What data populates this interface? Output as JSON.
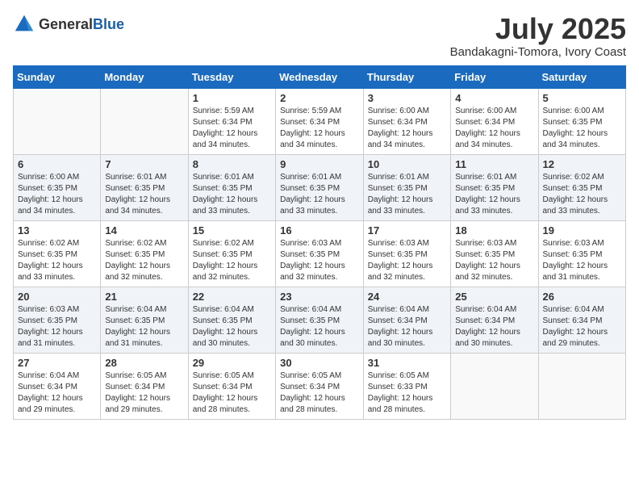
{
  "header": {
    "logo_general": "General",
    "logo_blue": "Blue",
    "month_title": "July 2025",
    "location": "Bandakagni-Tomora, Ivory Coast"
  },
  "days_of_week": [
    "Sunday",
    "Monday",
    "Tuesday",
    "Wednesday",
    "Thursday",
    "Friday",
    "Saturday"
  ],
  "weeks": [
    [
      {
        "day": "",
        "info": ""
      },
      {
        "day": "",
        "info": ""
      },
      {
        "day": "1",
        "info": "Sunrise: 5:59 AM\nSunset: 6:34 PM\nDaylight: 12 hours and 34 minutes."
      },
      {
        "day": "2",
        "info": "Sunrise: 5:59 AM\nSunset: 6:34 PM\nDaylight: 12 hours and 34 minutes."
      },
      {
        "day": "3",
        "info": "Sunrise: 6:00 AM\nSunset: 6:34 PM\nDaylight: 12 hours and 34 minutes."
      },
      {
        "day": "4",
        "info": "Sunrise: 6:00 AM\nSunset: 6:34 PM\nDaylight: 12 hours and 34 minutes."
      },
      {
        "day": "5",
        "info": "Sunrise: 6:00 AM\nSunset: 6:35 PM\nDaylight: 12 hours and 34 minutes."
      }
    ],
    [
      {
        "day": "6",
        "info": "Sunrise: 6:00 AM\nSunset: 6:35 PM\nDaylight: 12 hours and 34 minutes."
      },
      {
        "day": "7",
        "info": "Sunrise: 6:01 AM\nSunset: 6:35 PM\nDaylight: 12 hours and 34 minutes."
      },
      {
        "day": "8",
        "info": "Sunrise: 6:01 AM\nSunset: 6:35 PM\nDaylight: 12 hours and 33 minutes."
      },
      {
        "day": "9",
        "info": "Sunrise: 6:01 AM\nSunset: 6:35 PM\nDaylight: 12 hours and 33 minutes."
      },
      {
        "day": "10",
        "info": "Sunrise: 6:01 AM\nSunset: 6:35 PM\nDaylight: 12 hours and 33 minutes."
      },
      {
        "day": "11",
        "info": "Sunrise: 6:01 AM\nSunset: 6:35 PM\nDaylight: 12 hours and 33 minutes."
      },
      {
        "day": "12",
        "info": "Sunrise: 6:02 AM\nSunset: 6:35 PM\nDaylight: 12 hours and 33 minutes."
      }
    ],
    [
      {
        "day": "13",
        "info": "Sunrise: 6:02 AM\nSunset: 6:35 PM\nDaylight: 12 hours and 33 minutes."
      },
      {
        "day": "14",
        "info": "Sunrise: 6:02 AM\nSunset: 6:35 PM\nDaylight: 12 hours and 32 minutes."
      },
      {
        "day": "15",
        "info": "Sunrise: 6:02 AM\nSunset: 6:35 PM\nDaylight: 12 hours and 32 minutes."
      },
      {
        "day": "16",
        "info": "Sunrise: 6:03 AM\nSunset: 6:35 PM\nDaylight: 12 hours and 32 minutes."
      },
      {
        "day": "17",
        "info": "Sunrise: 6:03 AM\nSunset: 6:35 PM\nDaylight: 12 hours and 32 minutes."
      },
      {
        "day": "18",
        "info": "Sunrise: 6:03 AM\nSunset: 6:35 PM\nDaylight: 12 hours and 32 minutes."
      },
      {
        "day": "19",
        "info": "Sunrise: 6:03 AM\nSunset: 6:35 PM\nDaylight: 12 hours and 31 minutes."
      }
    ],
    [
      {
        "day": "20",
        "info": "Sunrise: 6:03 AM\nSunset: 6:35 PM\nDaylight: 12 hours and 31 minutes."
      },
      {
        "day": "21",
        "info": "Sunrise: 6:04 AM\nSunset: 6:35 PM\nDaylight: 12 hours and 31 minutes."
      },
      {
        "day": "22",
        "info": "Sunrise: 6:04 AM\nSunset: 6:35 PM\nDaylight: 12 hours and 30 minutes."
      },
      {
        "day": "23",
        "info": "Sunrise: 6:04 AM\nSunset: 6:35 PM\nDaylight: 12 hours and 30 minutes."
      },
      {
        "day": "24",
        "info": "Sunrise: 6:04 AM\nSunset: 6:34 PM\nDaylight: 12 hours and 30 minutes."
      },
      {
        "day": "25",
        "info": "Sunrise: 6:04 AM\nSunset: 6:34 PM\nDaylight: 12 hours and 30 minutes."
      },
      {
        "day": "26",
        "info": "Sunrise: 6:04 AM\nSunset: 6:34 PM\nDaylight: 12 hours and 29 minutes."
      }
    ],
    [
      {
        "day": "27",
        "info": "Sunrise: 6:04 AM\nSunset: 6:34 PM\nDaylight: 12 hours and 29 minutes."
      },
      {
        "day": "28",
        "info": "Sunrise: 6:05 AM\nSunset: 6:34 PM\nDaylight: 12 hours and 29 minutes."
      },
      {
        "day": "29",
        "info": "Sunrise: 6:05 AM\nSunset: 6:34 PM\nDaylight: 12 hours and 28 minutes."
      },
      {
        "day": "30",
        "info": "Sunrise: 6:05 AM\nSunset: 6:34 PM\nDaylight: 12 hours and 28 minutes."
      },
      {
        "day": "31",
        "info": "Sunrise: 6:05 AM\nSunset: 6:33 PM\nDaylight: 12 hours and 28 minutes."
      },
      {
        "day": "",
        "info": ""
      },
      {
        "day": "",
        "info": ""
      }
    ]
  ]
}
